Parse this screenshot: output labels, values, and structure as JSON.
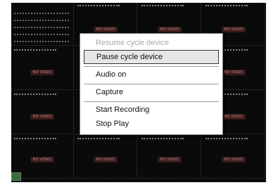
{
  "context_menu": {
    "items": [
      {
        "label": "Resume cycle device",
        "state": "disabled"
      },
      {
        "label": "Pause cycle device",
        "state": "highlighted"
      },
      {
        "label": "Audio on",
        "state": "enabled"
      },
      {
        "label": "Capture",
        "state": "enabled"
      },
      {
        "label": "Start Recording",
        "state": "enabled"
      },
      {
        "label": "Stop Play",
        "state": "enabled"
      }
    ]
  },
  "grid": {
    "channel_placeholder": "NO VIDEO",
    "rows": 4,
    "columns": 4
  },
  "colors": {
    "screen_background": "#0a0a0a",
    "no_video_text": "#d08a8a",
    "menu_background": "#ffffff",
    "highlight_border": "#333333"
  }
}
